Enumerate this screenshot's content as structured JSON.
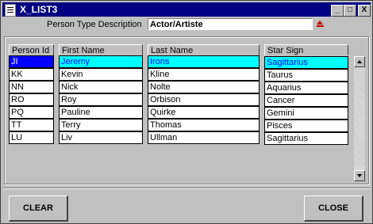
{
  "window": {
    "title": "X_LIST3",
    "minimize": "_",
    "maximize": "□",
    "close": "X"
  },
  "person_type": {
    "label": "Person Type Description",
    "value": "Actor/Artiste"
  },
  "columns": {
    "person_id": "Person Id",
    "first_name": "First Name",
    "last_name": "Last Name",
    "star_sign": "Star Sign"
  },
  "rows": [
    {
      "person_id": "JI",
      "first_name": "Jeremy",
      "last_name": "Irons"
    },
    {
      "person_id": "KK",
      "first_name": "Kevin",
      "last_name": "Kline"
    },
    {
      "person_id": "NN",
      "first_name": "Nick",
      "last_name": "Nolte"
    },
    {
      "person_id": "RO",
      "first_name": "Roy",
      "last_name": "Orbison"
    },
    {
      "person_id": "PQ",
      "first_name": "Pauline",
      "last_name": "Quirke"
    },
    {
      "person_id": "TT",
      "first_name": "Terry",
      "last_name": "Thomas"
    },
    {
      "person_id": "LU",
      "first_name": "Liv",
      "last_name": "Ullman"
    }
  ],
  "star_signs": [
    "Sagittarius",
    "Taurus",
    "Aquarius",
    "Cancer",
    "Gemini",
    "Pisces",
    "Sagittarius"
  ],
  "buttons": {
    "clear": "CLEAR",
    "close": "CLOSE"
  },
  "colors": {
    "title_bar": "#000080",
    "selected_row": "#00ffff",
    "selected_id": "#0000ff",
    "face": "#c0c0c0"
  }
}
